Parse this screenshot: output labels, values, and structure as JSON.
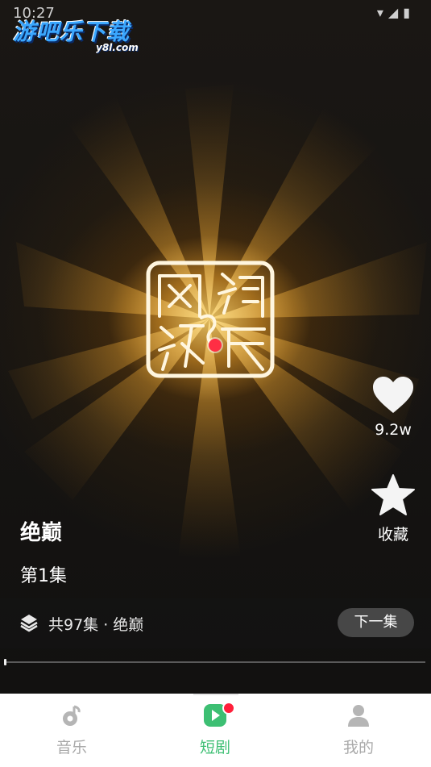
{
  "status_bar": {
    "time": "10:27"
  },
  "watermark": {
    "title": "游吧乐下载",
    "subtitle": "y8l.com"
  },
  "video": {
    "rec_color": "#ff2e44"
  },
  "actions": {
    "like": {
      "icon": "heart-icon",
      "label": "9.2w"
    },
    "favorite": {
      "icon": "star-icon",
      "label": "收藏"
    }
  },
  "drama": {
    "title": "绝巅",
    "episode": "第1集"
  },
  "series": {
    "icon": "layers-icon",
    "info": "共97集 · 绝巅",
    "next_label": "下一集"
  },
  "progress": {
    "value": 0.0
  },
  "tabbar": {
    "items": [
      {
        "label": "音乐",
        "icon": "music-note-icon",
        "active": false
      },
      {
        "label": "短剧",
        "icon": "play-icon",
        "active": true,
        "badge": true
      },
      {
        "label": "我的",
        "icon": "user-icon",
        "active": false
      }
    ],
    "active_color": "#3dbf73",
    "inactive_color": "#a9a9a9",
    "badge_color": "#ff1f3a"
  }
}
